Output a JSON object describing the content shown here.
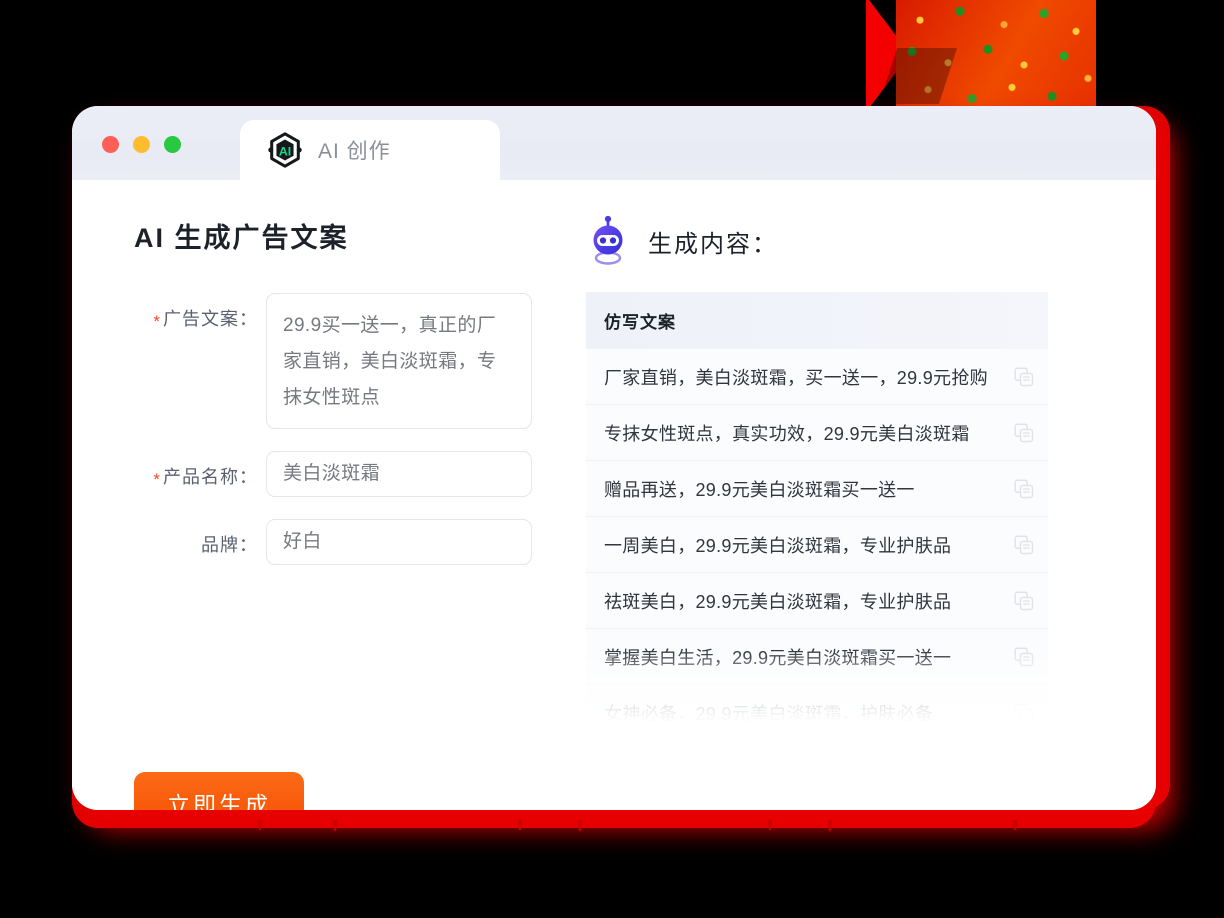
{
  "window": {
    "traffic_lights": [
      {
        "name": "close",
        "color": "#ff5f57"
      },
      {
        "name": "minimize",
        "color": "#febc2e"
      },
      {
        "name": "maximize",
        "color": "#28c840"
      }
    ],
    "tab": {
      "label": "AI 创作",
      "logo_text": "AI",
      "logo_icon": "ai-hexagon-logo"
    }
  },
  "left": {
    "title": "AI 生成广告文案",
    "fields": [
      {
        "label": "广告文案：",
        "required": true,
        "type": "textarea",
        "value": "29.9买一送一，真正的厂家直销，美白淡斑霜，专抹女性斑点"
      },
      {
        "label": "产品名称：",
        "required": true,
        "type": "input",
        "value": "美白淡斑霜"
      },
      {
        "label": "品牌：",
        "required": false,
        "type": "input",
        "value": "好白"
      }
    ],
    "submit_label": "立即生成",
    "submit_color": "#f85c0b",
    "required_star": "*",
    "required_star_color": "#f5492a"
  },
  "right": {
    "icon": "robot-head-icon",
    "icon_color": "#5b3fe0",
    "title": "生成内容：",
    "table": {
      "columns": [
        "仿写文案"
      ],
      "copy_icon": "copy-icon",
      "rows": [
        {
          "index": "1",
          "text": "厂家直销，美白淡斑霜，买一送一，29.9元抢购",
          "faded": false
        },
        {
          "index": "2",
          "text": "专抹女性斑点，真实功效，29.9元美白淡斑霜",
          "faded": false
        },
        {
          "index": "3",
          "text": "赠品再送，29.9元美白淡斑霜买一送一",
          "faded": false
        },
        {
          "index": "4",
          "text": "一周美白，29.9元美白淡斑霜，专业护肤品",
          "faded": false
        },
        {
          "index": "5",
          "text": "祛斑美白，29.9元美白淡斑霜，专业护肤品",
          "faded": false
        },
        {
          "index": "6",
          "text": "掌握美白生活，29.9元美白淡斑霜买一送一",
          "faded": false
        },
        {
          "index": "7",
          "text": "女神必备，29.9元美白淡斑霜，护肤必备",
          "faded": true
        }
      ]
    }
  }
}
